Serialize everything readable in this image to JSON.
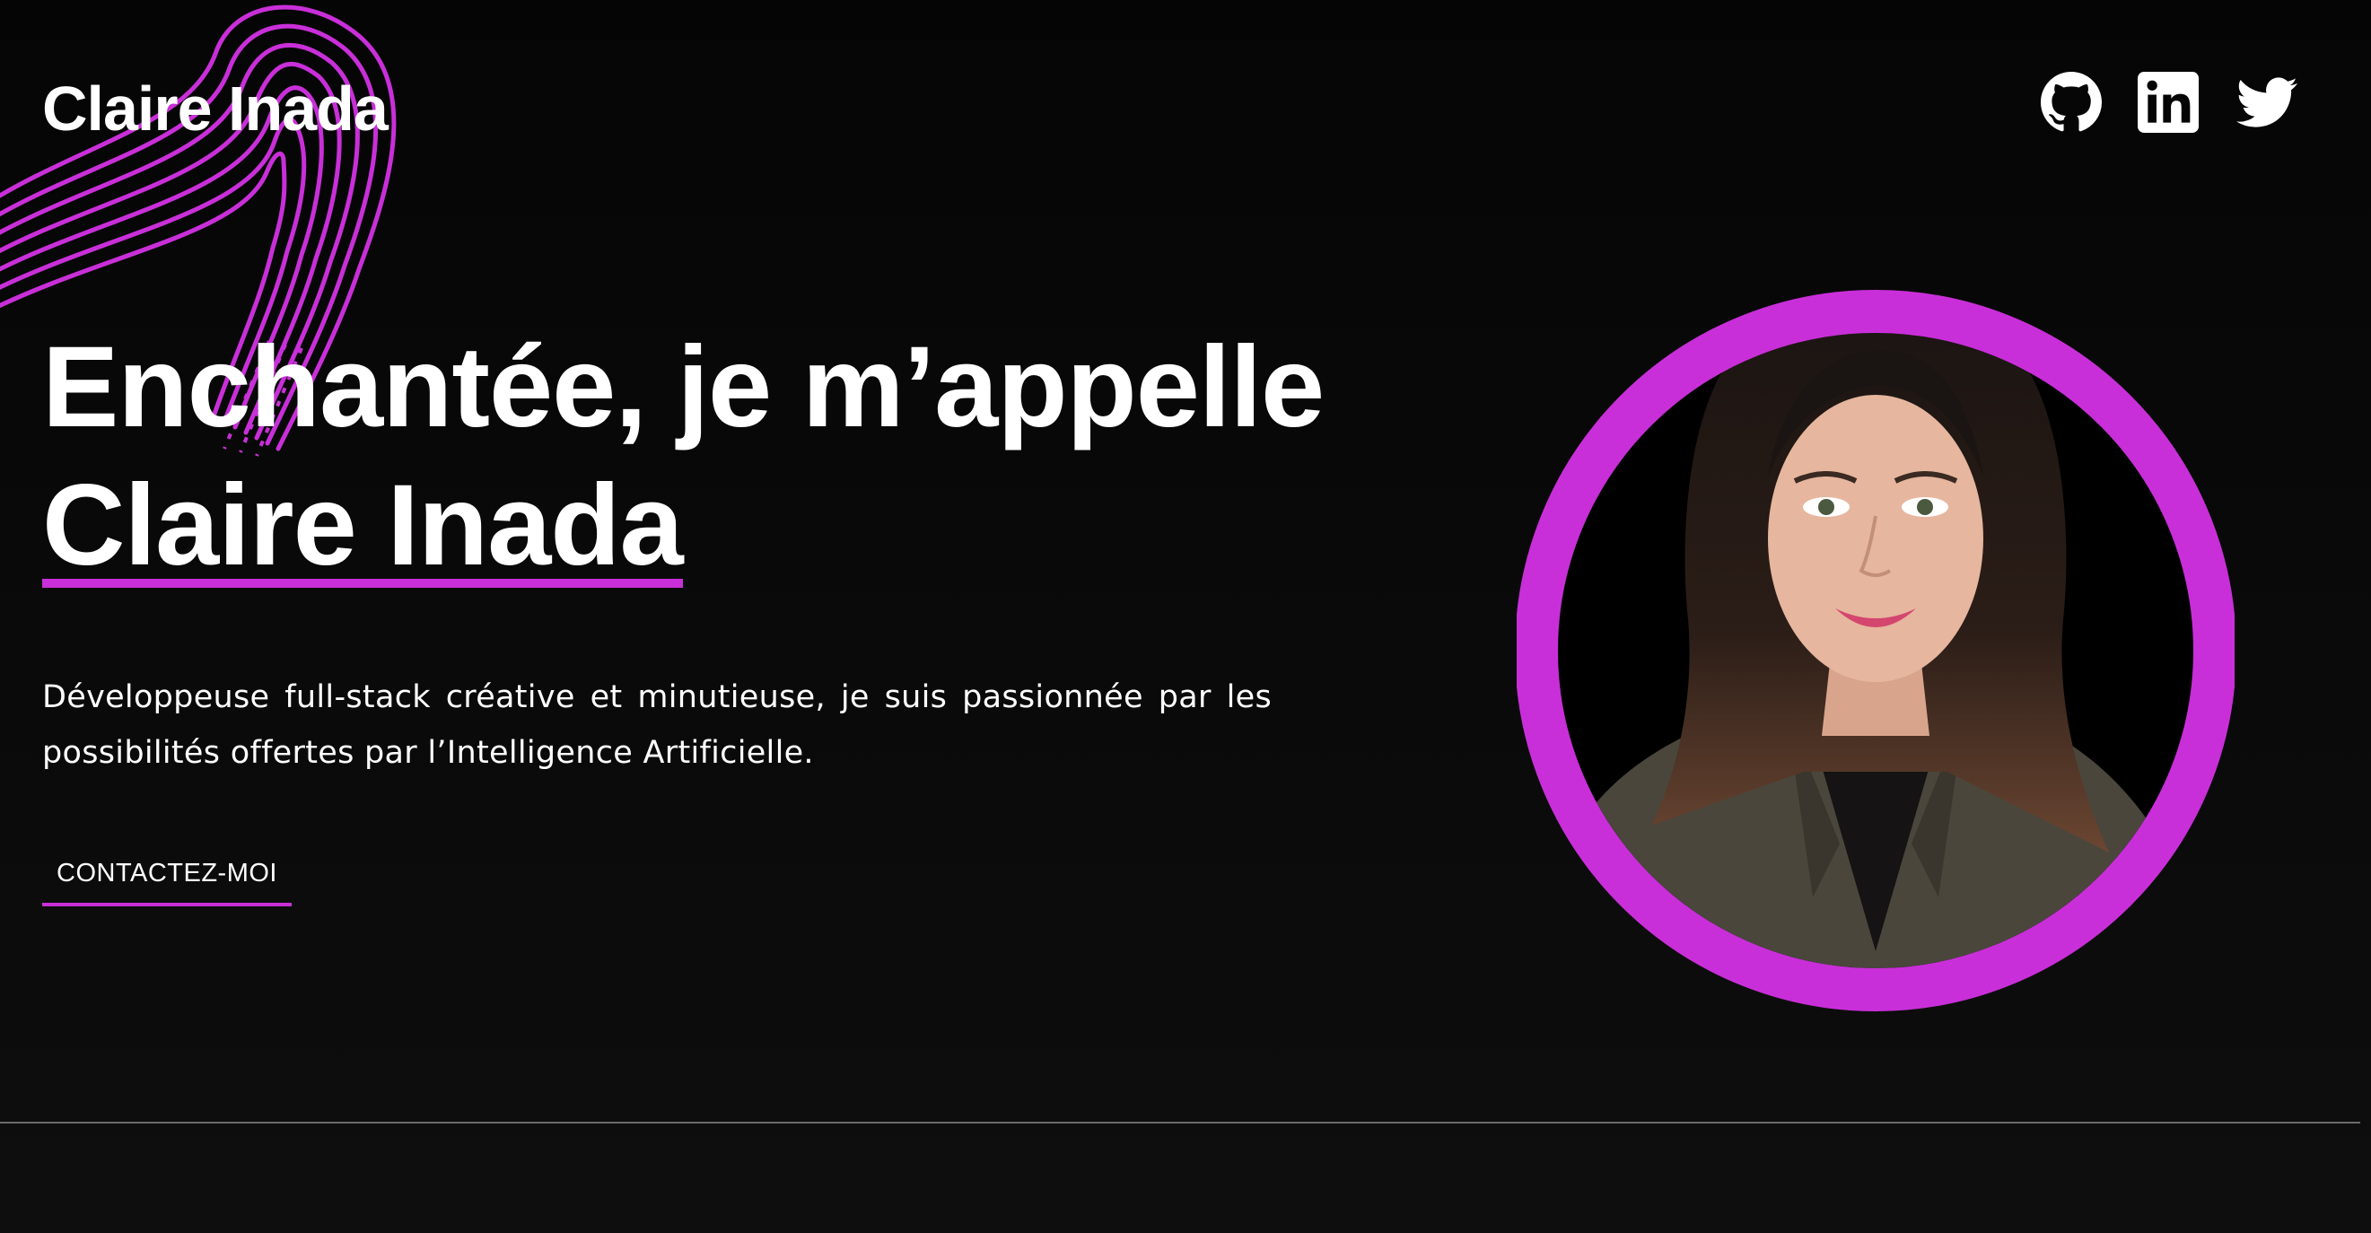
{
  "header": {
    "brand": "Claire Inada",
    "social_links": [
      {
        "icon": "github-icon"
      },
      {
        "icon": "linkedin-icon"
      },
      {
        "icon": "twitter-icon"
      }
    ]
  },
  "hero": {
    "title_line1": "Enchantée, je m’appelle",
    "title_name": "Claire Inada",
    "intro": "Développeuse full-stack créative et minutieuse, je suis passionnée par les possibilités offertes par l’Intelligence Artificielle.",
    "cta_label": "CONTACTEZ-MOI"
  },
  "colors": {
    "accent": "#c92fd9",
    "background": "#050505",
    "text": "#ffffff",
    "divider": "#6b6b6b"
  }
}
